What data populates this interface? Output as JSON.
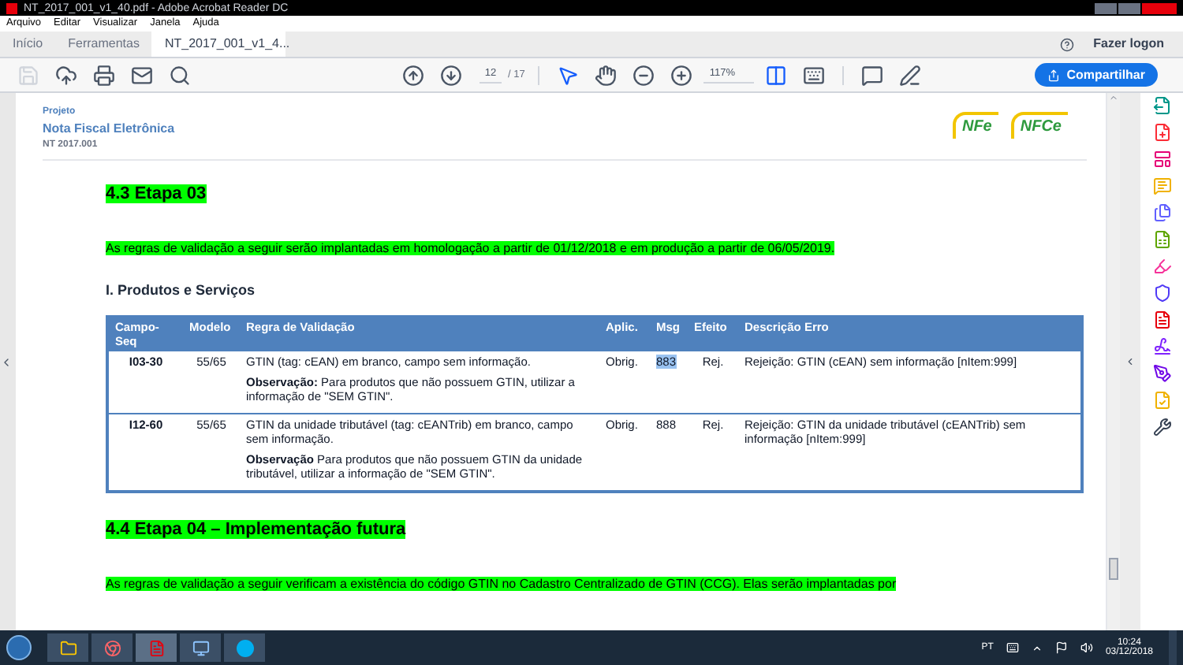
{
  "window": {
    "title": "NT_2017_001_v1_40.pdf - Adobe Acrobat Reader DC"
  },
  "menu": [
    "Arquivo",
    "Editar",
    "Visualizar",
    "Janela",
    "Ajuda"
  ],
  "tabs": [
    {
      "label": "Início",
      "selected": false
    },
    {
      "label": "Ferramentas",
      "selected": false
    },
    {
      "label": "NT_2017_001_v1_4...",
      "selected": true
    }
  ],
  "account": {
    "login": "Fazer logon"
  },
  "toolbar": {
    "page": "12",
    "page_total": "/ 17",
    "zoom": "117%",
    "share": "Compartilhar"
  },
  "document": {
    "header": {
      "project": "Projeto",
      "title": "Nota Fiscal Eletrônica",
      "code": "NT 2017.001",
      "logos": [
        "NFe",
        "NFCe"
      ]
    },
    "sections": [
      {
        "heading": "4.3  Etapa 03",
        "paragraph": "As regras de validação a seguir serão implantadas em homologação a partir de 01/12/2018 e em produção a partir de 06/05/2019.",
        "subheading": "I. Produtos e Serviços",
        "table": {
          "columns": [
            "Campo-Seq",
            "Modelo",
            "Regra de Validação",
            "Aplic.",
            "Msg",
            "Efeito",
            "Descrição Erro"
          ],
          "rows": [
            {
              "campo": "I03-30",
              "modelo": "55/65",
              "regra": "GTIN (tag: cEAN) em branco, campo sem informação.",
              "observacao": "**Observação:** Para produtos que não possuem GTIN, utilizar a informação de \"SEM GTIN\".",
              "aplic": "Obrig.",
              "msg": "883",
              "msg_selected": true,
              "efeito": "Rej.",
              "descricao": "Rejeição: GTIN (cEAN) sem informação [nItem:999]"
            },
            {
              "campo": "I12-60",
              "modelo": "55/65",
              "regra": "GTIN da unidade tributável (tag: cEANTrib) em branco, campo sem informação.",
              "observacao": "**Observação** Para produtos que não possuem GTIN da unidade tributável, utilizar a informação de \"SEM GTIN\".",
              "aplic": "Obrig.",
              "msg": "888",
              "msg_selected": false,
              "efeito": "Rej.",
              "descricao": "Rejeição: GTIN da unidade tributável (cEANTrib) sem informação [nItem:999]"
            }
          ]
        }
      },
      {
        "heading": "4.4  Etapa 04 – Implementação futura",
        "paragraph": "As regras de validação a seguir verificam a existência do código GTIN no Cadastro Centralizado de GTIN (CCG). Elas serão implantadas por"
      }
    ]
  },
  "taskbar": {
    "language": "PT",
    "time": "10:24",
    "date": "03/12/2018"
  }
}
